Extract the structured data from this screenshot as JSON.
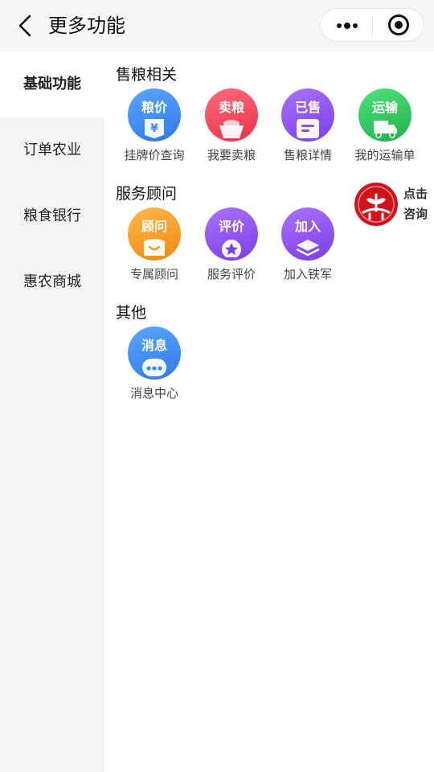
{
  "header": {
    "title": "更多功能",
    "back_icon": "chevron-left-icon",
    "more_icon": "more-dots-icon",
    "close_icon": "target-close-icon"
  },
  "sidebar": {
    "items": [
      {
        "label": "基础功能",
        "active": true
      },
      {
        "label": "订单农业",
        "active": false
      },
      {
        "label": "粮食银行",
        "active": false
      },
      {
        "label": "惠农商城",
        "active": false
      }
    ]
  },
  "sections": [
    {
      "title": "售粮相关",
      "tiles": [
        {
          "icon_text": "粮价",
          "label": "挂牌价查询",
          "icon": "price-yen-icon",
          "color": "#3d8ef0"
        },
        {
          "icon_text": "卖粮",
          "label": "我要卖粮",
          "icon": "grain-basket-icon",
          "color": "#f0475a"
        },
        {
          "icon_text": "已售",
          "label": "售粮详情",
          "icon": "document-icon",
          "color": "#8b4ff0"
        },
        {
          "icon_text": "运输",
          "label": "我的运输单",
          "icon": "truck-icon",
          "color": "#2fc85a"
        }
      ]
    },
    {
      "title": "服务顾问",
      "tiles": [
        {
          "icon_text": "顾问",
          "label": "专属顾问",
          "icon": "advisor-person-icon",
          "color": "#f79d20"
        },
        {
          "icon_text": "评价",
          "label": "服务评价",
          "icon": "star-badge-icon",
          "color": "#8b4ff0"
        },
        {
          "icon_text": "加入",
          "label": "加入铁军",
          "icon": "layers-icon",
          "color": "#8b4ff0"
        }
      ]
    },
    {
      "title": "其他",
      "tiles": [
        {
          "icon_text": "消息",
          "label": "消息中心",
          "icon": "chat-bubble-icon",
          "color": "#3d8ef0"
        }
      ]
    }
  ],
  "consult": {
    "text_line1": "点击",
    "text_line2": "咨询",
    "logo_icon": "wheat-logo-icon",
    "color": "#d0121b"
  }
}
